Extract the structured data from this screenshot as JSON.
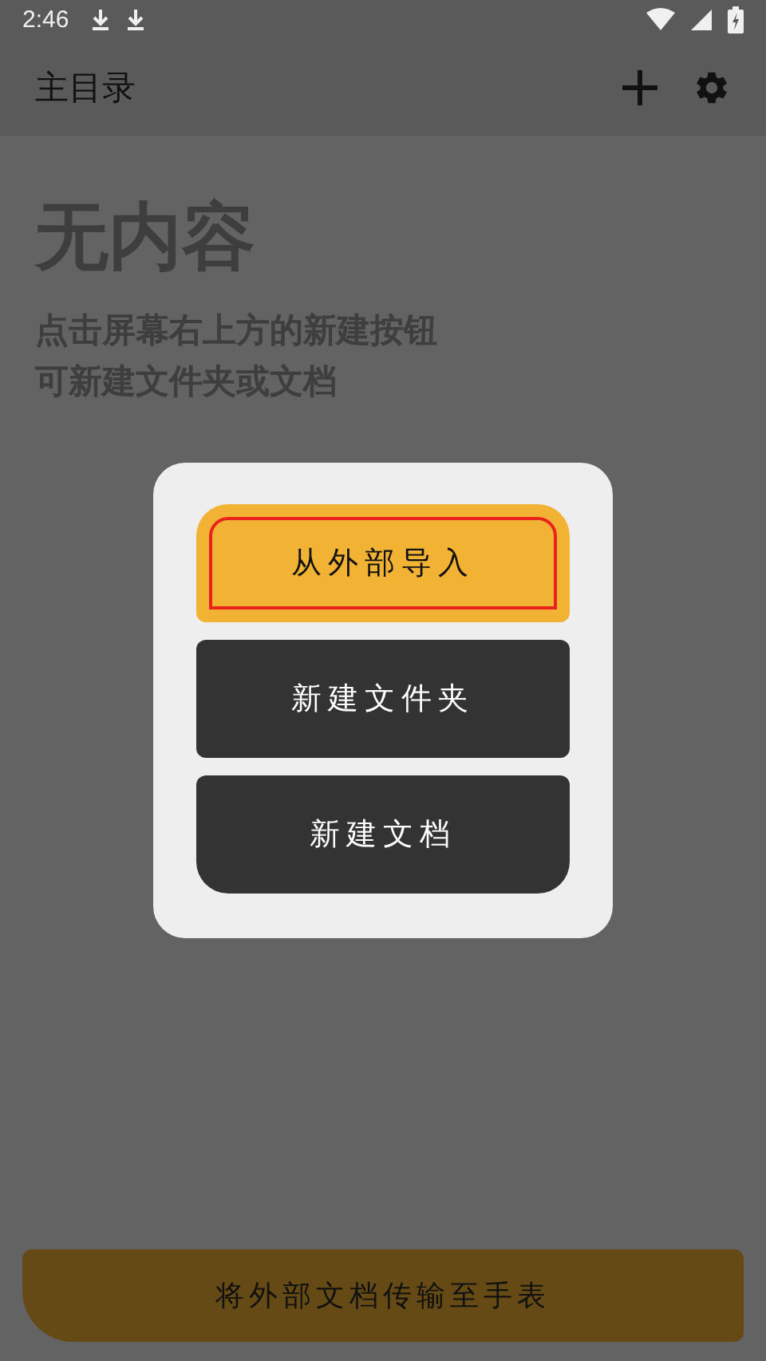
{
  "status_bar": {
    "time": "2:46"
  },
  "app_bar": {
    "title": "主目录"
  },
  "empty_state": {
    "title": "无内容",
    "lines": [
      "点击屏幕右上方的新建按钮",
      "可新建文件夹或文档"
    ]
  },
  "dialog": {
    "buttons": [
      {
        "label": "从外部导入",
        "kind": "primary",
        "highlighted": true
      },
      {
        "label": "新建文件夹",
        "kind": "secondary",
        "highlighted": false
      },
      {
        "label": "新建文档",
        "kind": "secondary",
        "highlighted": false
      }
    ]
  },
  "bottom_button": {
    "label": "将外部文档传输至手表"
  }
}
